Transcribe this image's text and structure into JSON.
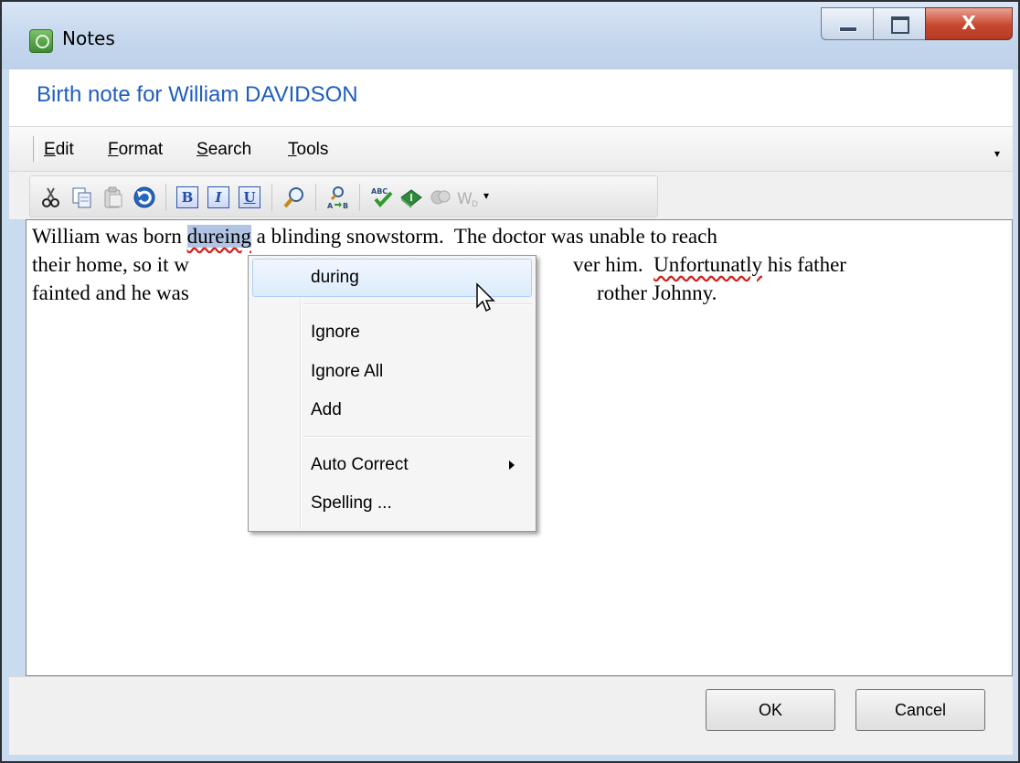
{
  "window": {
    "title": "Notes",
    "close_glyph": "X"
  },
  "heading": "Birth note for William DAVIDSON",
  "menubar": {
    "items": [
      {
        "accel": "E",
        "rest": "dit"
      },
      {
        "accel": "F",
        "rest": "ormat"
      },
      {
        "accel": "S",
        "rest": "earch"
      },
      {
        "accel": "T",
        "rest": "ools"
      }
    ],
    "overflow_glyph": "▾"
  },
  "toolbar": {
    "icons": [
      "cut-icon",
      "copy-icon",
      "paste-icon",
      "undo-icon",
      "bold-icon",
      "italic-icon",
      "underline-icon",
      "find-icon",
      "replace-icon",
      "spellcheck-icon",
      "thesaurus-icon",
      "disabled-tool-icon",
      "word-count-icon"
    ],
    "bold_label": "B",
    "italic_label": "I",
    "underline_label": "U",
    "dropdown_glyph": "▾"
  },
  "editor": {
    "line1_before": "William was born ",
    "line1_selected": "dureing",
    "line1_after": " a blinding snowstorm.  The doctor was unable to reach",
    "line2_left": "their home, so it w",
    "line2_right_before": "ver him.  ",
    "line2_misspelled": "Unfortunatly",
    "line2_right_after": " his father",
    "line3_left": "fainted and he was",
    "line3_right": "rother Johnny."
  },
  "context_menu": {
    "suggestion": "during",
    "ignore": "Ignore",
    "ignore_all": "Ignore All",
    "add": "Add",
    "auto_correct": "Auto Correct",
    "spelling": "Spelling ..."
  },
  "buttons": {
    "ok": "OK",
    "cancel": "Cancel"
  },
  "colors": {
    "heading": "#1f5ebf",
    "selection": "#b2c4e3",
    "misspelling_underline": "#d0201d"
  }
}
